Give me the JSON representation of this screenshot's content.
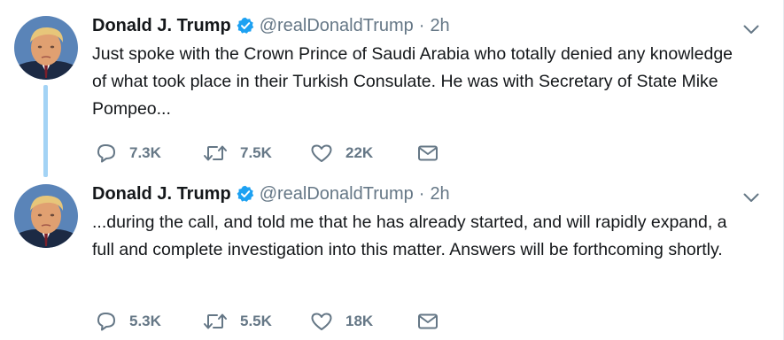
{
  "tweets": [
    {
      "author_name": "Donald J. Trump",
      "handle": "@realDonaldTrump",
      "separator": "·",
      "time": "2h",
      "text": "Just spoke with the Crown Prince of Saudi Arabia who totally denied any knowledge of what took place in their Turkish Consulate. He was with Secretary of State Mike Pompeo...",
      "replies": "7.3K",
      "retweets": "7.5K",
      "likes": "22K"
    },
    {
      "author_name": "Donald J. Trump",
      "handle": "@realDonaldTrump",
      "separator": "·",
      "time": "2h",
      "text": "...during the call, and told me that he has already started, and will rapidly expand, a full and complete investigation into this matter. Answers will be forthcoming shortly.",
      "replies": "5.3K",
      "retweets": "5.5K",
      "likes": "18K"
    }
  ],
  "icons": {
    "verified": "verified-badge-icon",
    "caret": "chevron-down-icon",
    "reply": "reply-icon",
    "retweet": "retweet-icon",
    "like": "heart-icon",
    "message": "envelope-icon"
  },
  "colors": {
    "text": "#14171a",
    "secondary": "#657786",
    "verified": "#1da1f2",
    "thread_line": "#a3d3f5"
  }
}
